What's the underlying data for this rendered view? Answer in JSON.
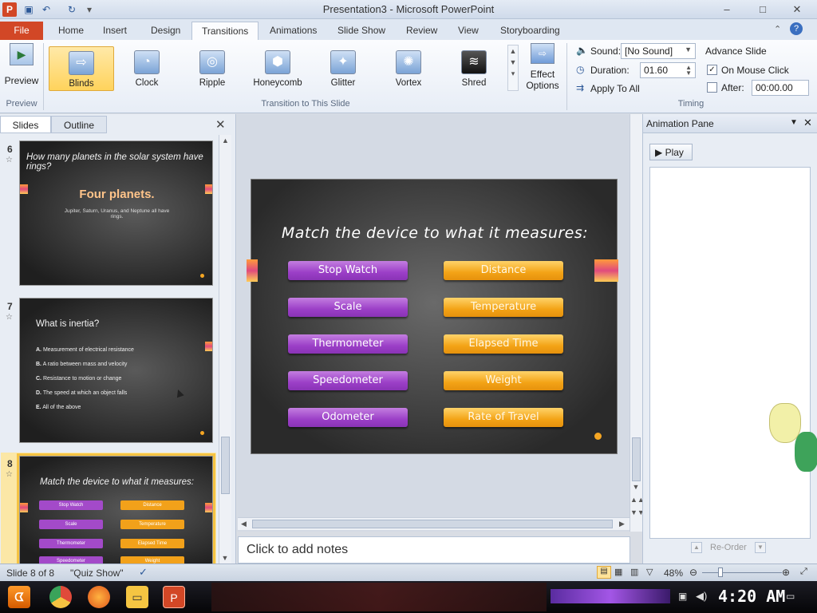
{
  "window": {
    "title": "Presentation3 - Microsoft PowerPoint",
    "app_icon": "P",
    "controls": [
      "–",
      "□",
      "✕"
    ]
  },
  "ribbon_tabs": [
    "File",
    "Home",
    "Insert",
    "Design",
    "Transitions",
    "Animations",
    "Slide Show",
    "Review",
    "View",
    "Storyboarding"
  ],
  "ribbon": {
    "preview_label": "Preview",
    "preview_group": "Preview",
    "transitions": [
      {
        "label": "Blinds",
        "icon": "⇨"
      },
      {
        "label": "Clock",
        "icon": "◔"
      },
      {
        "label": "Ripple",
        "icon": "◎"
      },
      {
        "label": "Honeycomb",
        "icon": "⬢"
      },
      {
        "label": "Glitter",
        "icon": "✦"
      },
      {
        "label": "Vortex",
        "icon": "✺"
      },
      {
        "label": "Shred",
        "icon": "≋"
      }
    ],
    "transition_group": "Transition to This Slide",
    "effect_options_1": "Effect",
    "effect_options_2": "Options",
    "sound_label": "Sound:",
    "sound_value": "[No Sound]",
    "duration_label": "Duration:",
    "duration_value": "01.60",
    "apply_all": "Apply To All",
    "advance_title": "Advance Slide",
    "on_mouse_click": "On Mouse Click",
    "after_label": "After:",
    "after_value": "00:00.00",
    "timing_group": "Timing"
  },
  "slide_pane": {
    "tab_slides": "Slides",
    "tab_outline": "Outline",
    "slides": [
      {
        "num": "6",
        "title": "How many planets in the solar system have rings?",
        "big": "Four planets.",
        "sub": "Jupiter, Saturn, Uranus, and Neptune all have rings."
      },
      {
        "num": "7",
        "title": "What is inertia?",
        "options": [
          {
            "letter": "A.",
            "text": "Measurement of electrical resistance"
          },
          {
            "letter": "B.",
            "text": "A ratio between mass and velocity"
          },
          {
            "letter": "C.",
            "text": "Resistance to motion or change"
          },
          {
            "letter": "D.",
            "text": "The speed at which an object falls"
          },
          {
            "letter": "E.",
            "text": "All of the above"
          }
        ]
      },
      {
        "num": "8",
        "title": "Match the device to what it measures:",
        "left": [
          "Stop Watch",
          "Scale",
          "Thermometer",
          "Speedometer"
        ],
        "right": [
          "Distance",
          "Temperature",
          "Elapsed Time",
          "Weight"
        ]
      }
    ]
  },
  "slide": {
    "title": "Match the device to what it measures:",
    "devices": [
      "Stop Watch",
      "Scale",
      "Thermometer",
      "Speedometer",
      "Odometer"
    ],
    "measures": [
      "Distance",
      "Temperature",
      "Elapsed Time",
      "Weight",
      "Rate of Travel"
    ]
  },
  "notes_placeholder": "Click to add notes",
  "animation_pane": {
    "title": "Animation Pane",
    "play": "Play",
    "reorder": "Re-Order"
  },
  "status": {
    "slide_of": "Slide 8 of 8",
    "theme": "\"Quiz Show\"",
    "zoom": "48%"
  },
  "taskbar": {
    "time": "4:20 AM"
  }
}
